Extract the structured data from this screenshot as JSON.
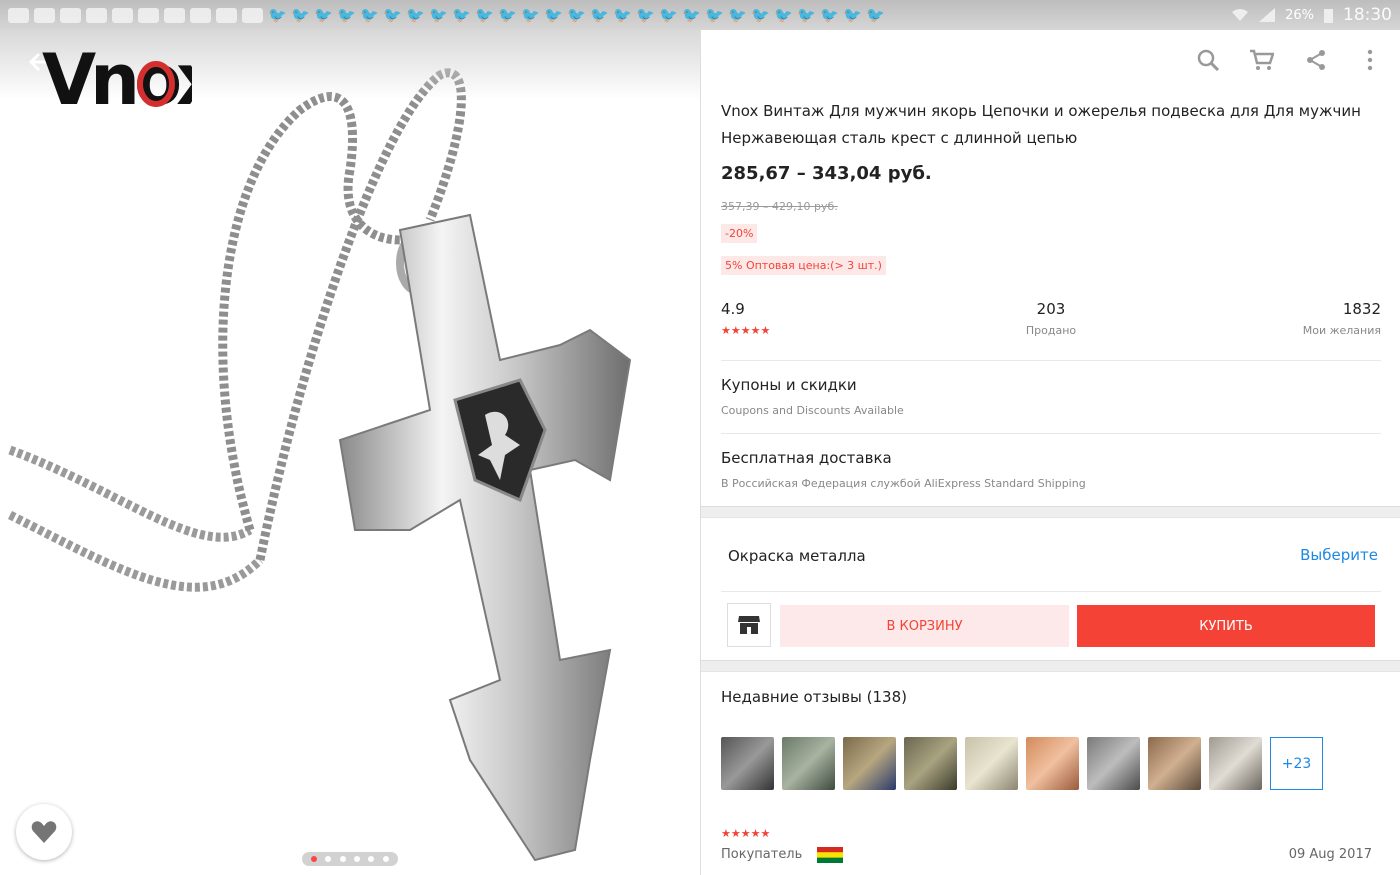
{
  "status_bar": {
    "battery": "26%",
    "time": "18:30"
  },
  "gallery": {
    "brand": "Vnox",
    "image_count": 6,
    "active_image": 1
  },
  "product": {
    "title": "Vnox Винтаж Для мужчин якорь Цепочки и ожерелья подвеска для Для мужчин Нержавеющая сталь крест с длинной цепью",
    "price": "285,67 – 343,04 руб.",
    "old_price": "357,39 – 429,10 руб.",
    "discount": "-20%",
    "wholesale": "5% Оптовая цена:(> 3 шт.)"
  },
  "stats": {
    "rating": "4.9",
    "stars": "★★★★★",
    "sold_value": "203",
    "sold_label": "Продано",
    "wish_value": "1832",
    "wish_label": "Мои желания"
  },
  "coupons": {
    "title": "Купоны и скидки",
    "subtitle": "Coupons and Discounts Available"
  },
  "shipping": {
    "title": "Бесплатная доставка",
    "subtitle": "В Российская Федерация службой AliExpress Standard Shipping"
  },
  "options": {
    "color_label": "Окраска металла",
    "select_label": "Выберите"
  },
  "actions": {
    "cart_label": "В КОРЗИНУ",
    "buy_label": "КУПИТЬ"
  },
  "reviews": {
    "title": "Недавние отзывы (138)",
    "more_label": "+23",
    "stars": "★★★★★",
    "reviewer": "Покупатель",
    "date": "09 Aug 2017"
  },
  "colors": {
    "accent_red": "#f44336",
    "link_blue": "#1e88e5"
  }
}
